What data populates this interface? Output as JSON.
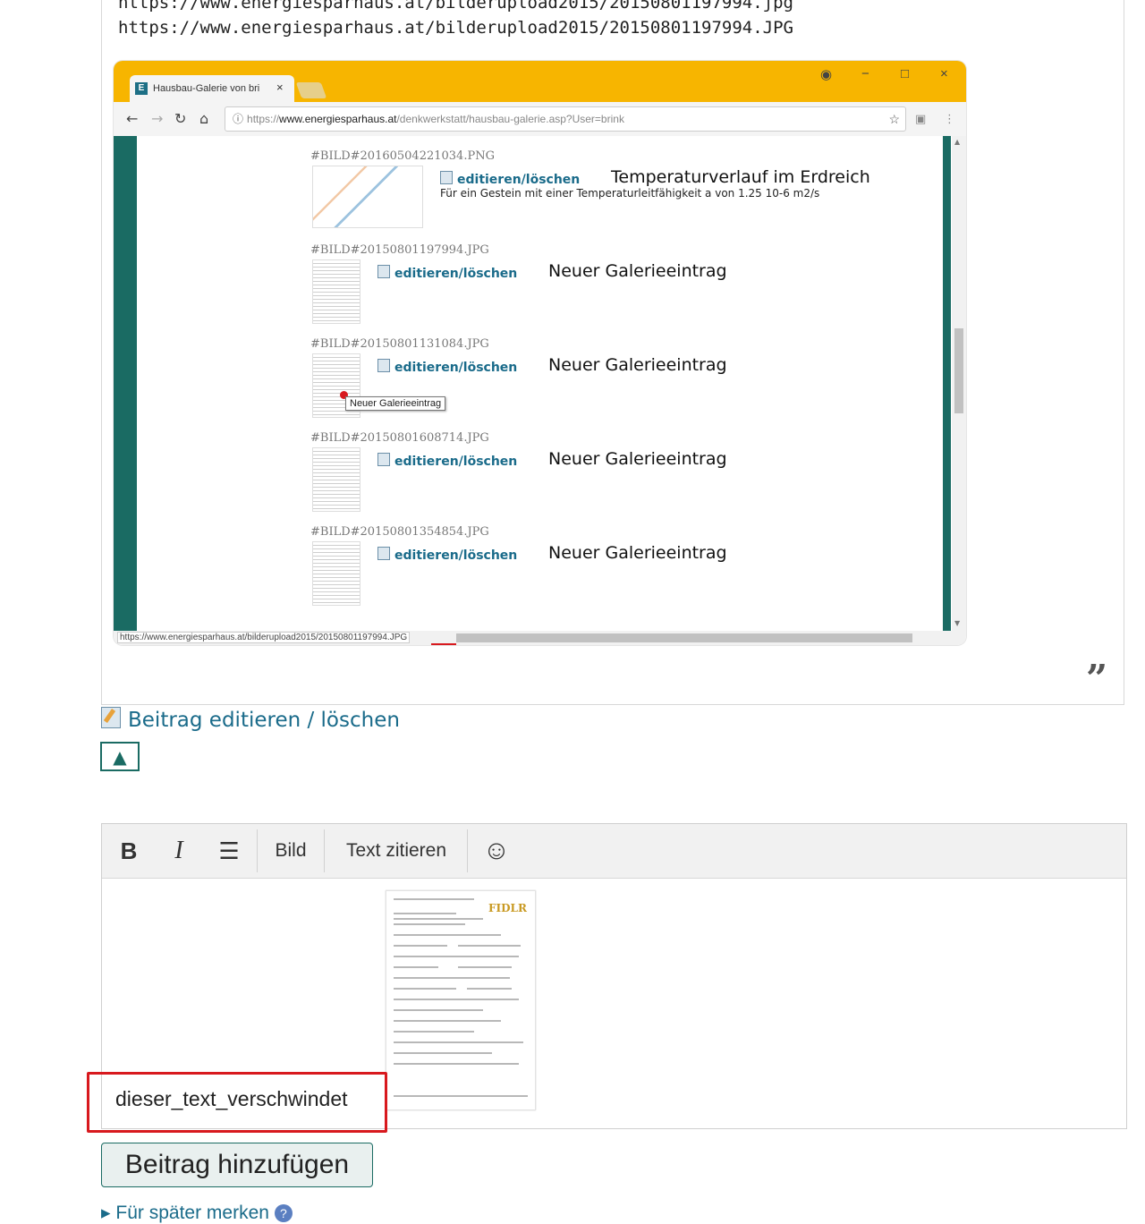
{
  "quote": {
    "urls": [
      "https://www.energiesparhaus.at/bilderupload2015/20150801197994.jpg",
      "https://www.energiesparhaus.at/bilderupload2015/20150801197994.JPG"
    ],
    "screenshot": {
      "tab_title": "Hausbau-Galerie von bri",
      "tab_close": "×",
      "window_controls": [
        "−",
        "□",
        "×"
      ],
      "profile_icon": "account-icon",
      "address": {
        "scheme": "https://",
        "host": "www.energiesparhaus.at",
        "path": "/denkwerkstatt/hausbau-galerie.asp?User=brink"
      },
      "entries": [
        {
          "id": "#BILD#20160504221034.PNG",
          "link": "editieren/löschen",
          "caption": "Temperaturverlauf im Erdreich",
          "subcaption": "Für ein Gestein mit einer Temperaturleitfähigkeit a von 1.25 10-6 m2/s"
        },
        {
          "id": "#BILD#20150801197994.JPG",
          "link": "editieren/löschen",
          "caption": "Neuer Galerieeintrag"
        },
        {
          "id": "#BILD#20150801131084.JPG",
          "link": "editieren/löschen",
          "caption": "Neuer Galerieeintrag"
        },
        {
          "id": "#BILD#20150801608714.JPG",
          "link": "editieren/löschen",
          "caption": "Neuer Galerieeintrag"
        },
        {
          "id": "#BILD#20150801354854.JPG",
          "link": "editieren/löschen",
          "caption": "Neuer Galerieeintrag"
        }
      ],
      "tooltip": "Neuer Galerieeintrag",
      "status_url": "https://www.energiesparhaus.at/bilderupload2015/20150801197994.JPG"
    },
    "quote_mark": "”"
  },
  "post_actions": {
    "edit_link": "Beitrag editieren / löschen",
    "up_button": "▲"
  },
  "editor": {
    "toolbar": {
      "bold": "B",
      "italic": "I",
      "list": "☰",
      "image": "Bild",
      "quote": "Text zitieren",
      "emoji": "☺"
    },
    "content_text": "dieser_text_verschwindet",
    "image_logo": "FIDLR"
  },
  "submit_label": "Beitrag hinzufügen",
  "bookmark_label": "Für später merken",
  "bookmark_help": "?",
  "colors": {
    "accent": "#1a6b63",
    "link": "#1a6b8a",
    "highlight": "#d8191e",
    "titlebar": "#f7b500"
  }
}
